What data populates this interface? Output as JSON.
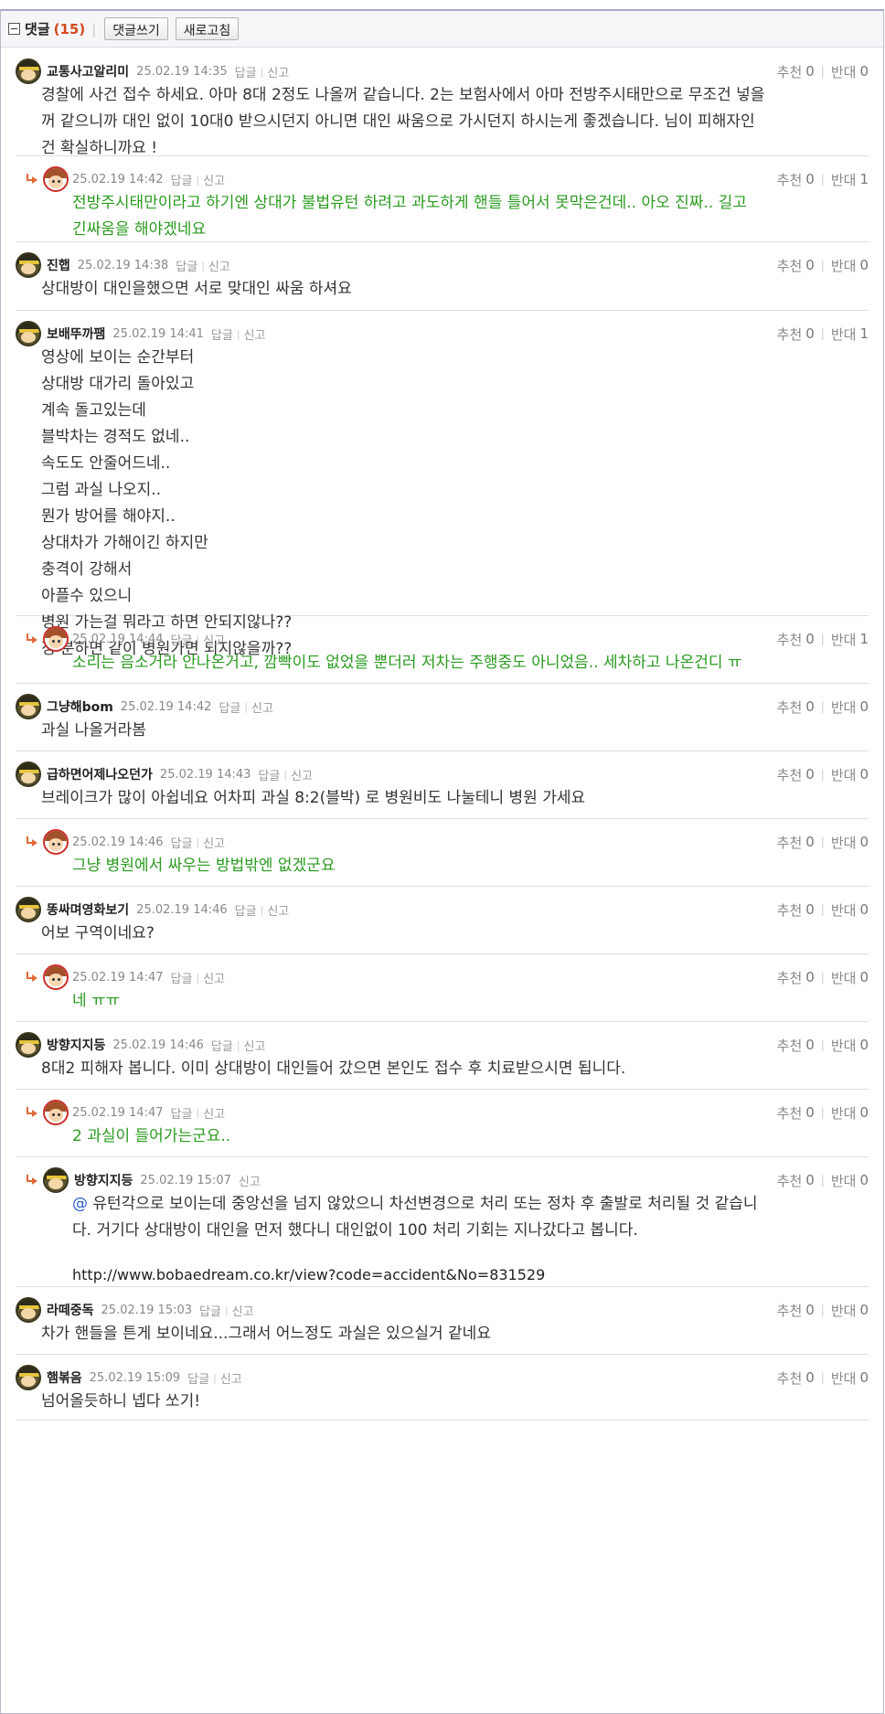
{
  "toolbar": {
    "title": "댓글",
    "count": "(15)",
    "write_button": "댓글쓰기",
    "refresh_button": "새로고침"
  },
  "labels": {
    "reply": "답글",
    "report": "신고",
    "recommend": "추천",
    "oppose": "반대"
  },
  "comments": [
    {
      "author": "교통사고알리미",
      "date": "25.02.19 14:35",
      "rec": "0",
      "opp": "0",
      "type": "main",
      "text": "경찰에 사건 접수 하세요. 아마 8대 2정도 나올꺼 같습니다. 2는 보험사에서 아마 전방주시태만으로 무조건 넣을\n꺼 같으니까 대인 없이 10대0 받으시던지 아니면 대인 싸움으로 가시던지 하시는게 좋겠습니다. 님이 피해자인\n건 확실하니까요 !"
    },
    {
      "author": "",
      "date": "25.02.19 14:42",
      "rec": "0",
      "opp": "1",
      "type": "reply",
      "text": "전방주시태만이라고 하기엔 상대가 불법유턴 하려고 과도하게 핸들 틀어서 못막은건데.. 아오 진짜.. 길고\n긴싸움을 해야겠네요"
    },
    {
      "author": "진햅",
      "date": "25.02.19 14:38",
      "rec": "0",
      "opp": "0",
      "type": "main",
      "text": "상대방이 대인을했으면 서로 맞대인 싸움 하셔요"
    },
    {
      "author": "보배뚜까팸",
      "date": "25.02.19 14:41",
      "rec": "0",
      "opp": "1",
      "type": "main",
      "text": "영상에 보이는 순간부터\n상대방 대가리 돌아있고\n계속 돌고있는데\n블박차는 경적도 없네..\n속도도 안줄어드네..\n그럼 과실 나오지..\n뭔가 방어를 해야지..\n상대차가 가해이긴 하지만\n충격이 강해서\n아플수 있으니\n병원 가는걸 뭐라고 하면 안되지않나??\n정 분하면 같이 병원가면 되지않을까??"
    },
    {
      "author": "",
      "date": "25.02.19 14:44",
      "rec": "0",
      "opp": "1",
      "type": "reply",
      "text": "소리는 음소거라 안나온거고, 깜빡이도 없었을 뿐더러 저차는 주행중도 아니었음.. 세차하고 나온건디 ㅠ"
    },
    {
      "author": "그냥해bom",
      "date": "25.02.19 14:42",
      "rec": "0",
      "opp": "0",
      "type": "main",
      "text": "과실 나올거라봄"
    },
    {
      "author": "급하면어제나오던가",
      "date": "25.02.19 14:43",
      "rec": "0",
      "opp": "0",
      "type": "main",
      "text": "브레이크가 많이 아쉽네요 어차피 과실 8:2(블박) 로 병원비도 나눌테니 병원 가세요"
    },
    {
      "author": "",
      "date": "25.02.19 14:46",
      "rec": "0",
      "opp": "0",
      "type": "reply",
      "text": "그냥 병원에서 싸우는 방법밖엔 없겠군요"
    },
    {
      "author": "똥싸며영화보기",
      "date": "25.02.19 14:46",
      "rec": "0",
      "opp": "0",
      "type": "main",
      "text": "어보 구역이네요?"
    },
    {
      "author": "",
      "date": "25.02.19 14:47",
      "rec": "0",
      "opp": "0",
      "type": "reply",
      "text": "네 ㅠㅠ"
    },
    {
      "author": "방향지지등",
      "date": "25.02.19 14:46",
      "rec": "0",
      "opp": "0",
      "type": "main",
      "text": "8대2 피해자 봅니다. 이미 상대방이 대인들어 갔으면 본인도 접수 후 치료받으시면 됩니다."
    },
    {
      "author": "",
      "date": "25.02.19 14:47",
      "rec": "0",
      "opp": "0",
      "type": "reply",
      "text": "2 과실이 들어가는군요.."
    },
    {
      "author": "방향지지등",
      "date": "25.02.19 15:07",
      "rec": "0",
      "opp": "0",
      "type": "reply-named",
      "mention": "@",
      "text": " 유턴각으로 보이는데 중앙선을 넘지 않았으니 차선변경으로 처리 또는 정차 후 출발로 처리될 것 같습니\n다. 거기다 상대방이 대인을 먼저 했다니 대인없이 100 처리 기회는 지나갔다고 봅니다.",
      "link": "http://www.bobaedream.co.kr/view?code=accident&No=831529"
    },
    {
      "author": "라떼중독",
      "date": "25.02.19 15:03",
      "rec": "0",
      "opp": "0",
      "type": "main",
      "text": "차가 핸들을 튼게 보이네요...그래서 어느정도 과실은 있으실거 같네요"
    },
    {
      "author": "햄볶음",
      "date": "25.02.19 15:09",
      "rec": "0",
      "opp": "0",
      "type": "main",
      "text": "넘어올듯하니 넵다 쏘기!"
    }
  ]
}
